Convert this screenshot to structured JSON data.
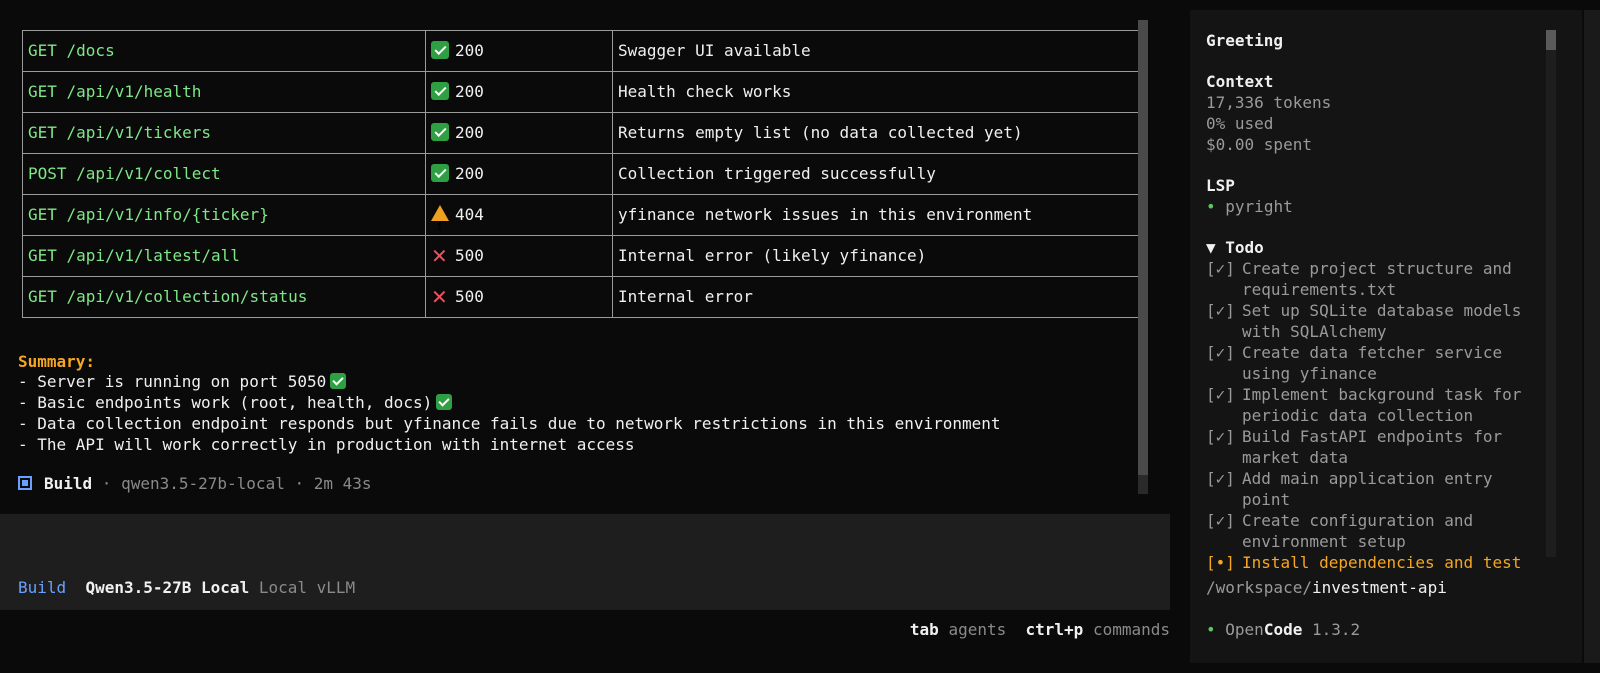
{
  "table": {
    "rows": [
      {
        "endpoint": "GET /docs",
        "status_icon": "check-icon",
        "status": "200",
        "note": "Swagger UI available"
      },
      {
        "endpoint": "GET /api/v1/health",
        "status_icon": "check-icon",
        "status": "200",
        "note": "Health check works"
      },
      {
        "endpoint": "GET /api/v1/tickers",
        "status_icon": "check-icon",
        "status": "200",
        "note": "Returns empty list (no data collected yet)"
      },
      {
        "endpoint": "POST /api/v1/collect",
        "status_icon": "check-icon",
        "status": "200",
        "note": "Collection triggered successfully"
      },
      {
        "endpoint": "GET /api/v1/info/{ticker}",
        "status_icon": "warning-icon",
        "status": "404",
        "note": "yfinance network issues in this environment"
      },
      {
        "endpoint": "GET /api/v1/latest/all",
        "status_icon": "cross-icon",
        "status": "500",
        "note": "Internal error (likely yfinance)"
      },
      {
        "endpoint": "GET /api/v1/collection/status",
        "status_icon": "cross-icon",
        "status": "500",
        "note": "Internal error"
      }
    ]
  },
  "summary": {
    "title": "Summary:",
    "lines": [
      "- Server is running on port 5050",
      "- Basic endpoints work (root, health, docs)",
      "- Data collection endpoint responds but yfinance fails due to network restrictions in this environment",
      "- The API will work correctly in production with internet access"
    ]
  },
  "build_status": {
    "label": "Build",
    "detail": " · qwen3.5-27b-local · 2m 43s"
  },
  "agent_line": {
    "mode": "Build",
    "model": "Qwen3.5-27B Local",
    "provider": "Local vLLM"
  },
  "hints": {
    "key1": "tab",
    "label1": "agents",
    "key2": "ctrl+p",
    "label2": "commands"
  },
  "sidebar": {
    "greeting": "Greeting",
    "context_title": "Context",
    "tokens": "17,336 tokens",
    "used": "0% used",
    "spent": "$0.00 spent",
    "lsp_title": "LSP",
    "lsp_item": "pyright",
    "todo_title": "▼ Todo",
    "todos": [
      {
        "box": "[✓]",
        "text": "Create project structure and requirements.txt"
      },
      {
        "box": "[✓]",
        "text": "Set up SQLite database models with SQLAlchemy"
      },
      {
        "box": "[✓]",
        "text": "Create data fetcher service using yfinance"
      },
      {
        "box": "[✓]",
        "text": "Implement background task for periodic data collection"
      },
      {
        "box": "[✓]",
        "text": "Build FastAPI endpoints for market data"
      },
      {
        "box": "[✓]",
        "text": "Add main application entry point"
      },
      {
        "box": "[✓]",
        "text": "Create configuration and environment setup"
      },
      {
        "box": "[•]",
        "text": "Install dependencies and test"
      }
    ],
    "workspace_prefix": "/workspace/",
    "workspace_name": "investment-api",
    "version_prefix": "Open",
    "version_brand": "Code",
    "version": "1.3.2"
  },
  "colors": {
    "accent_blue": "#6aa0ff",
    "endpoint_green": "#7ee787",
    "summary_orange": "#f5a623",
    "ok_green": "#2ea043",
    "error_red": "#f05060"
  }
}
